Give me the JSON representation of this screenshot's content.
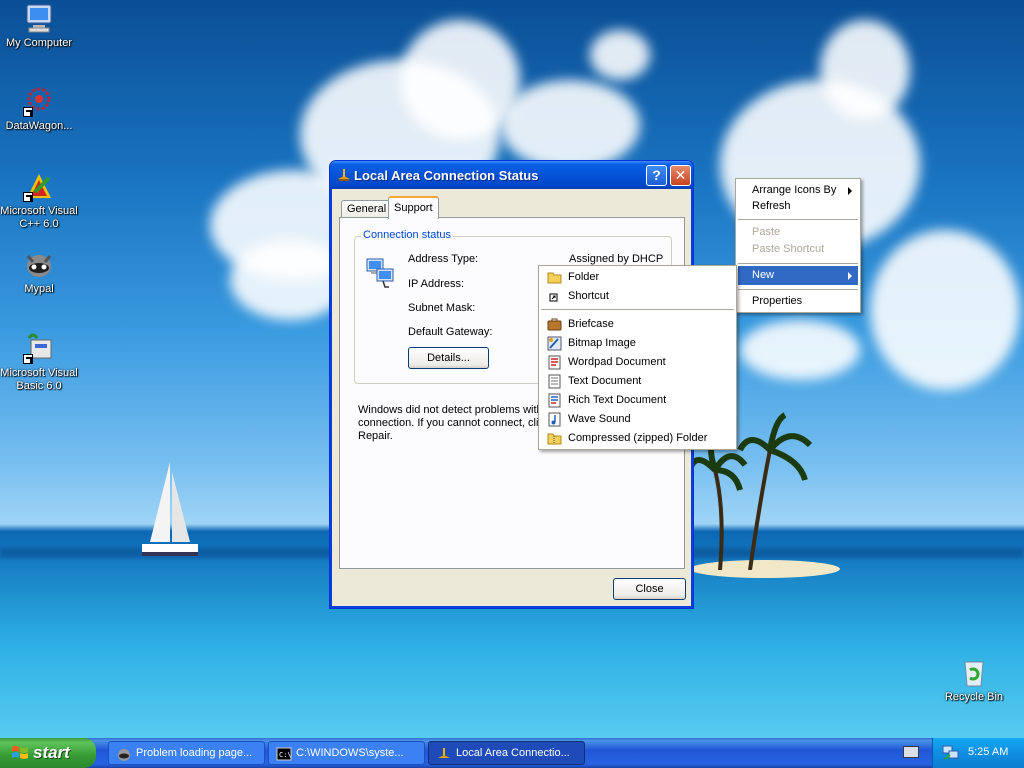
{
  "desktop": {
    "icons": [
      {
        "label": "My Computer",
        "icon": "my-computer-icon"
      },
      {
        "label": "DataWagon...",
        "icon": "datawagon-icon"
      },
      {
        "label": "Microsoft Visual C++ 6.0",
        "icon": "visual-cpp-icon"
      },
      {
        "label": "Mypal",
        "icon": "mypal-icon"
      },
      {
        "label": "Microsoft Visual Basic 6.0",
        "icon": "visual-basic-icon"
      },
      {
        "label": "Recycle Bin",
        "icon": "recycle-bin-icon"
      }
    ]
  },
  "dialog": {
    "title": "Local Area Connection Status",
    "help_glyph": "?",
    "close_glyph": "✕",
    "tabs": [
      {
        "label": "General",
        "active": false
      },
      {
        "label": "Support",
        "active": true
      }
    ],
    "group_title": "Connection status",
    "rows": [
      {
        "label": "Address Type:",
        "value": "Assigned by DHCP"
      },
      {
        "label": "IP Address:",
        "value": ""
      },
      {
        "label": "Subnet Mask:",
        "value": ""
      },
      {
        "label": "Default Gateway:",
        "value": ""
      }
    ],
    "details_button": "Details...",
    "status_line1": "Windows did not detect problems with",
    "status_line2": "connection. If you cannot connect, clic",
    "status_line3": "Repair.",
    "close_button": "Close"
  },
  "context_menu": {
    "items": [
      {
        "label": "Arrange Icons By",
        "submenu": true,
        "disabled": false
      },
      {
        "label": "Refresh",
        "submenu": false,
        "disabled": false
      },
      {
        "label": "Paste",
        "submenu": false,
        "disabled": true
      },
      {
        "label": "Paste Shortcut",
        "submenu": false,
        "disabled": true
      },
      {
        "label": "New",
        "submenu": true,
        "disabled": false,
        "selected": true
      },
      {
        "label": "Properties",
        "submenu": false,
        "disabled": false
      }
    ]
  },
  "new_menu": {
    "items": [
      {
        "label": "Folder",
        "icon": "folder-icon"
      },
      {
        "label": "Shortcut",
        "icon": "shortcut-icon"
      },
      {
        "label": "Briefcase",
        "icon": "briefcase-icon"
      },
      {
        "label": "Bitmap Image",
        "icon": "bitmap-icon"
      },
      {
        "label": "Wordpad Document",
        "icon": "wordpad-icon"
      },
      {
        "label": "Text Document",
        "icon": "text-document-icon"
      },
      {
        "label": "Rich Text Document",
        "icon": "rich-text-icon"
      },
      {
        "label": "Wave Sound",
        "icon": "wave-sound-icon"
      },
      {
        "label": "Compressed (zipped) Folder",
        "icon": "zip-folder-icon"
      }
    ]
  },
  "taskbar": {
    "start_label": "start",
    "tasks": [
      {
        "label": "Problem loading page...",
        "icon": "mypal-icon",
        "active": false
      },
      {
        "label": "C:\\WINDOWS\\syste...",
        "icon": "cmd-icon",
        "active": false
      },
      {
        "label": "Local Area Connectio...",
        "icon": "network-icon",
        "active": true
      }
    ],
    "clock": "5:25 AM"
  },
  "colors": {
    "title_blue": "#0553d8",
    "menu_highlight": "#316ac5",
    "start_green": "#379a35",
    "taskbar_blue": "#2157d7"
  }
}
